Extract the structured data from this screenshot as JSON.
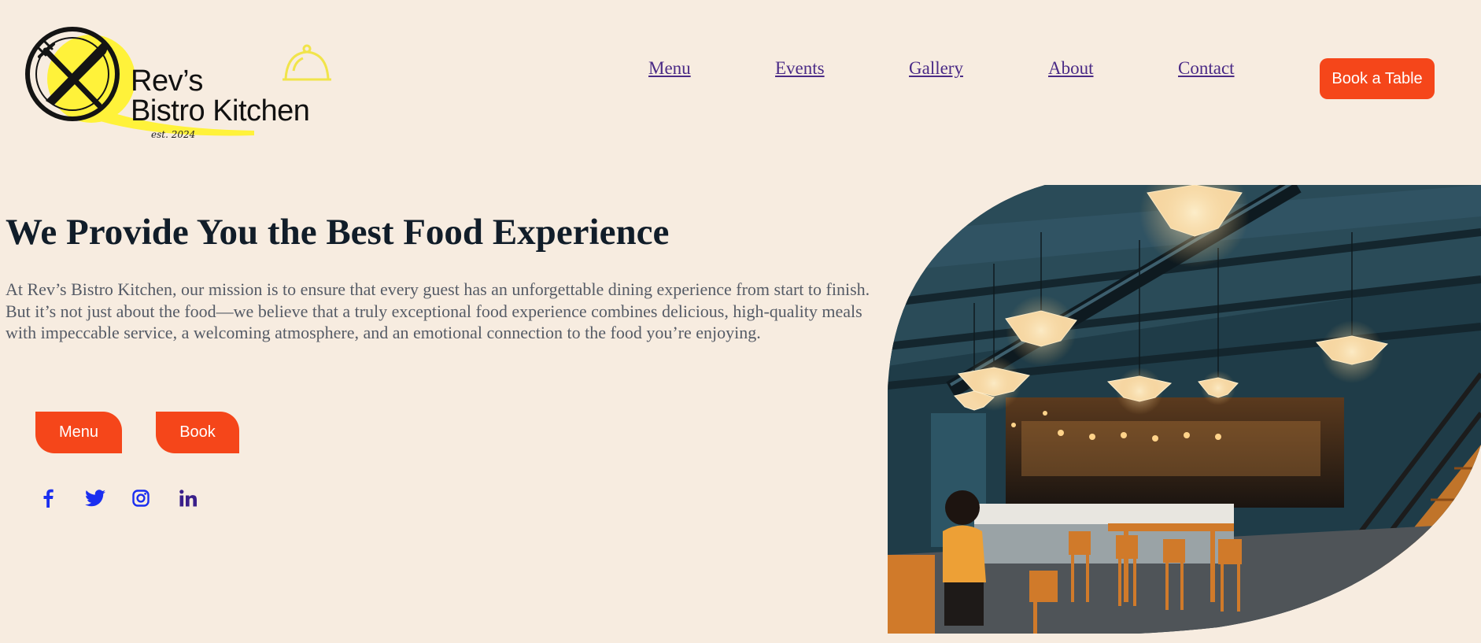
{
  "brand": {
    "name_line1": "Rev’s",
    "name_line2": "Bistro Kitchen",
    "established": "est. 2024",
    "accent_yellow": "#fff23a"
  },
  "nav": {
    "items": [
      {
        "label": "Menu"
      },
      {
        "label": "Events"
      },
      {
        "label": "Gallery"
      },
      {
        "label": "About"
      },
      {
        "label": "Contact"
      }
    ],
    "cta_label": "Book a Table",
    "link_color": "#4a2a86"
  },
  "hero": {
    "title": "We Provide You the Best Food Experience",
    "body": "At Rev’s Bistro Kitchen, our mission is to ensure that every guest has an unforgettable dining experience from start to finish. But it’s not just about the food—we believe that a truly exceptional food experience combines delicious, high-quality meals with impeccable service, a welcoming atmosphere, and an emotional connection to the food you’re enjoying.",
    "buttons": {
      "menu_label": "Menu",
      "book_label": "Book"
    },
    "accent_color": "#f5461a",
    "image": {
      "subject": "restaurant-interior-photo"
    }
  },
  "socials": [
    {
      "icon": "facebook-icon",
      "color": "#1a2ef0"
    },
    {
      "icon": "twitter-icon",
      "color": "#1a2ef0"
    },
    {
      "icon": "instagram-icon",
      "color": "#1a2ef0"
    },
    {
      "icon": "linkedin-icon",
      "color": "#3a1f8a"
    }
  ]
}
